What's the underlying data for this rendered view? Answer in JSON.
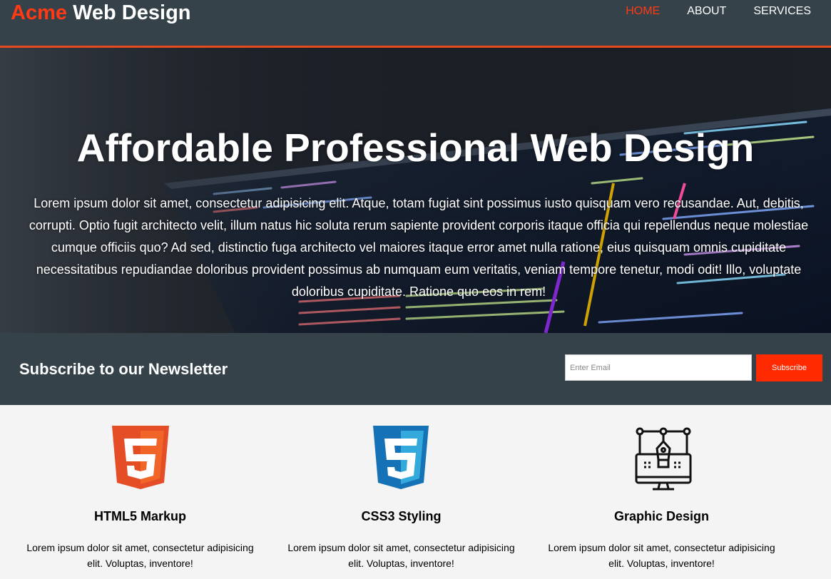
{
  "header": {
    "brand_highlight": "Acme",
    "brand_rest": "Web Design",
    "nav": [
      {
        "label": "HOME",
        "active": true
      },
      {
        "label": "ABOUT",
        "active": false
      },
      {
        "label": "SERVICES",
        "active": false
      }
    ]
  },
  "hero": {
    "title": "Affordable Professional Web Design",
    "text": "Lorem ipsum dolor sit amet, consectetur adipisicing elit. Atque, totam fugiat sint possimus iusto quisquam vero recusandae. Aut, debitis, corrupti. Optio fugit architecto velit, illum natus hic soluta rerum sapiente provident corporis itaque officia qui repellendus neque molestiae cumque officiis quo? Ad sed, distinctio fuga architecto vel maiores itaque error amet nulla ratione, eius quisquam omnis cupiditate necessitatibus repudiandae doloribus provident possimus ab numquam eum veritatis, veniam tempore tenetur, modi odit! Illo, voluptate doloribus cupiditate. Ratione quo eos in rem!"
  },
  "newsletter": {
    "title": "Subscribe to our Newsletter",
    "input_placeholder": "Enter Email",
    "button_label": "Subscribe"
  },
  "boxes": [
    {
      "icon": "html5-icon",
      "title": "HTML5 Markup",
      "text": "Lorem ipsum dolor sit amet, consectetur adipisicing elit. Voluptas, inventore!"
    },
    {
      "icon": "css3-icon",
      "title": "CSS3 Styling",
      "text": "Lorem ipsum dolor sit amet, consectetur adipisicing elit. Voluptas, inventore!"
    },
    {
      "icon": "graphic-design-icon",
      "title": "Graphic Design",
      "text": "Lorem ipsum dolor sit amet, consectetur adipisicing elit. Voluptas, inventore!"
    }
  ],
  "colors": {
    "header_bg": "#35424a",
    "accent": "#e8491d",
    "highlight": "#ff3a14",
    "button_bg": "#ff2a00",
    "section_bg": "#f4f4f4"
  }
}
